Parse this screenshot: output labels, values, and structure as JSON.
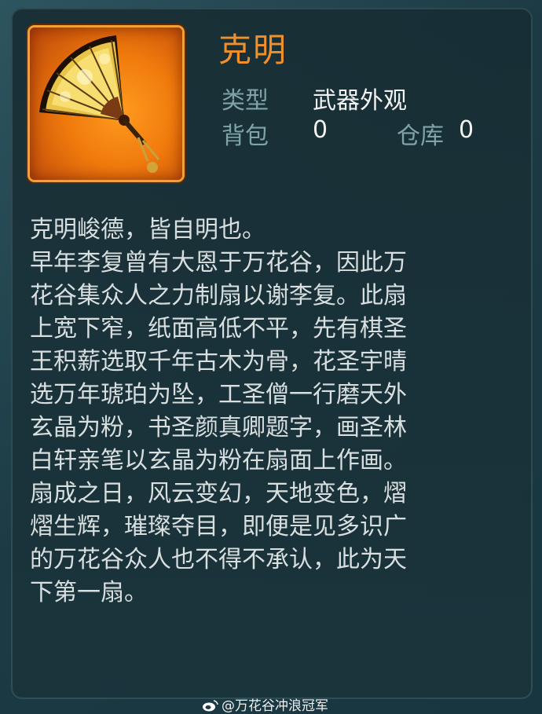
{
  "item": {
    "name": "克明",
    "type_label": "类型",
    "type_value": "武器外观",
    "bag_label": "背包",
    "bag_count": "0",
    "storage_label": "仓库",
    "storage_count": "0",
    "icon": "golden-fan-icon"
  },
  "description": [
    "克明峻德，皆自明也。",
    "早年李复曾有大恩于万花谷，因此万",
    "花谷集众人之力制扇以谢李复。此扇",
    "上宽下窄，纸面高低不平，先有棋圣",
    "王积薪选取千年古木为骨，花圣宇晴",
    "选万年琥珀为坠，工圣僧一行磨天外",
    "玄晶为粉，书圣颜真卿题字，画圣林",
    "白轩亲笔以玄晶为粉在扇面上作画。",
    "扇成之日，风云变幻，天地变色，熠",
    "熠生辉，璀璨夺目，即便是见多识广",
    "的万花谷众人也不得不承认，此为天",
    "下第一扇。"
  ],
  "watermark": "@万花谷冲浪冠军",
  "colors": {
    "title": "#f0902a",
    "label": "#7fa3a8",
    "value": "#f2f2f2",
    "text": "#d9dfdf",
    "icon_frame": "#f07a0c"
  }
}
